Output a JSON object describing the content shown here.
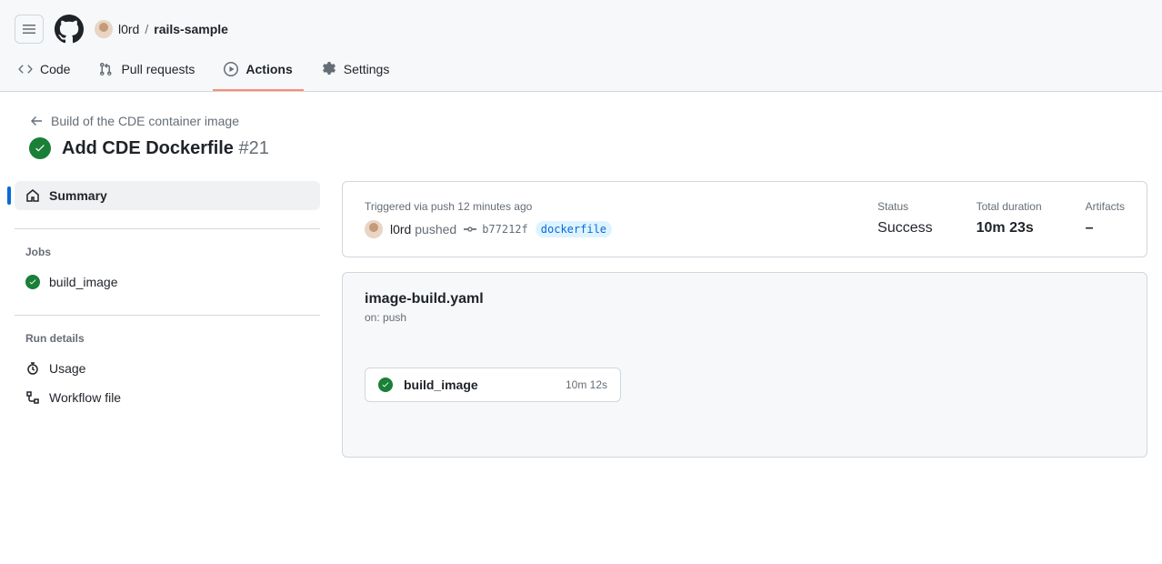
{
  "breadcrumb": {
    "owner": "l0rd",
    "repo": "rails-sample"
  },
  "tabs": {
    "code": "Code",
    "pulls": "Pull requests",
    "actions": "Actions",
    "settings": "Settings"
  },
  "back_label": "Build of the CDE container image",
  "title": "Add CDE Dockerfile",
  "run_number": "#21",
  "sidebar": {
    "summary": "Summary",
    "jobs_h": "Jobs",
    "job1": "build_image",
    "rundetails_h": "Run details",
    "usage": "Usage",
    "workflow_file": "Workflow file"
  },
  "summary": {
    "trigger_lbl": "Triggered via push 12 minutes ago",
    "actor": "l0rd",
    "verb": "pushed",
    "commit": "b77212f",
    "branch": "dockerfile",
    "status_lbl": "Status",
    "status": "Success",
    "duration_lbl": "Total duration",
    "duration": "10m 23s",
    "artifacts_lbl": "Artifacts",
    "artifacts": "–"
  },
  "workflow": {
    "file": "image-build.yaml",
    "on": "on: push",
    "job_name": "build_image",
    "job_time": "10m 12s"
  }
}
